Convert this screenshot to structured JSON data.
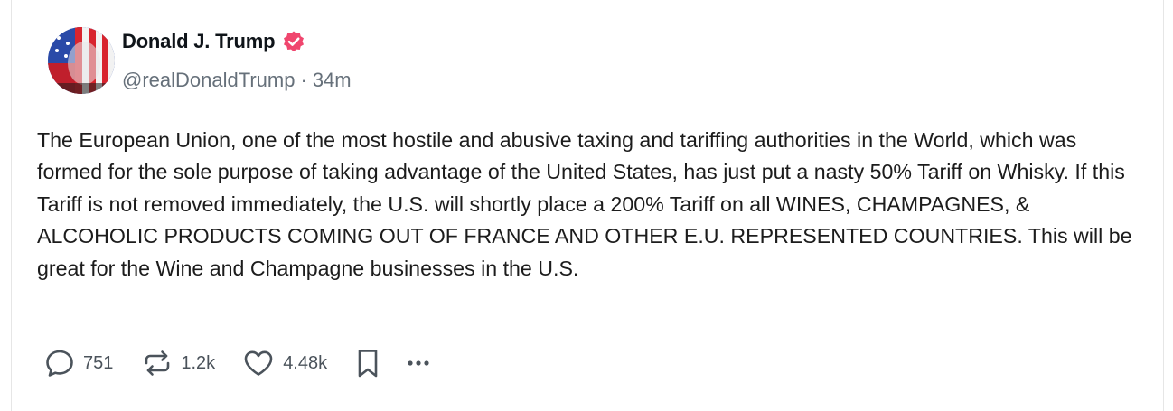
{
  "post": {
    "author_name": "Donald J. Trump",
    "handle": "@realDonaldTrump",
    "separator": "·",
    "time": "34m",
    "text": "The European Union, one of the most hostile and abusive taxing and tariffing authorities in the World, which was formed for the sole purpose of taking advantage of the United States, has just put a nasty 50% Tariff on Whisky. If this Tariff is not removed immediately, the U.S. will shortly place a 200% Tariff on all WINES, CHAMPAGNES, & ALCOHOLIC PRODUCTS COMING OUT OF FRANCE AND OTHER E.U. REPRESENTED COUNTRIES. This will be great for the Wine and Champagne businesses in the U.S."
  },
  "actions": {
    "replies": "751",
    "reposts": "1.2k",
    "likes": "4.48k"
  },
  "icons": {
    "reply": "speech-bubble-icon",
    "repost": "repost-arrows-icon",
    "like": "heart-icon",
    "bookmark": "bookmark-icon",
    "more": "ellipsis-icon",
    "verified": "verified-badge-icon"
  },
  "colors": {
    "verified_badge": "#f0466e",
    "handle_gray": "#66707a",
    "action_gray": "#4b535b"
  }
}
